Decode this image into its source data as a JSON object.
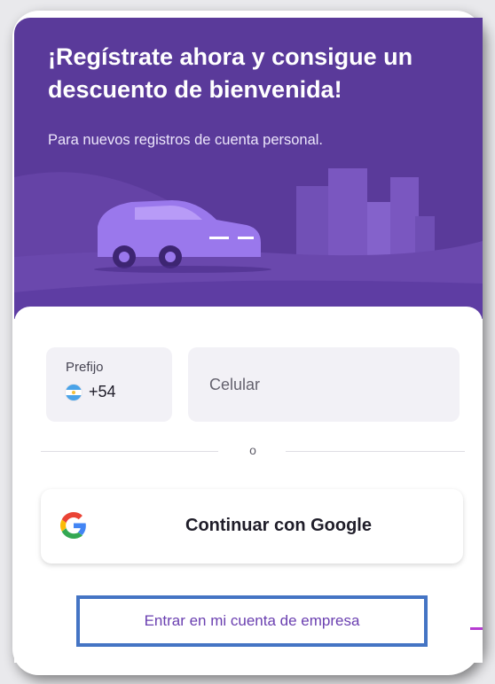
{
  "hero": {
    "title": "¡Regístrate ahora y consigue un descuento de bienvenida!",
    "subtitle": "Para nuevos registros de cuenta personal."
  },
  "phone": {
    "prefix_label": "Prefijo",
    "prefix_code": "+54",
    "prefix_flag": "argentina-flag-icon",
    "number_placeholder": "Celular"
  },
  "divider": {
    "text": "o"
  },
  "google": {
    "label": "Continuar con Google",
    "icon": "google-icon"
  },
  "business_link": {
    "label": "Entrar en mi cuenta de empresa"
  },
  "colors": {
    "hero_bg": "#5a3a9a",
    "accent_purple": "#6a3fb0",
    "highlight_border": "#4474c4",
    "input_bg": "#f2f1f6"
  }
}
